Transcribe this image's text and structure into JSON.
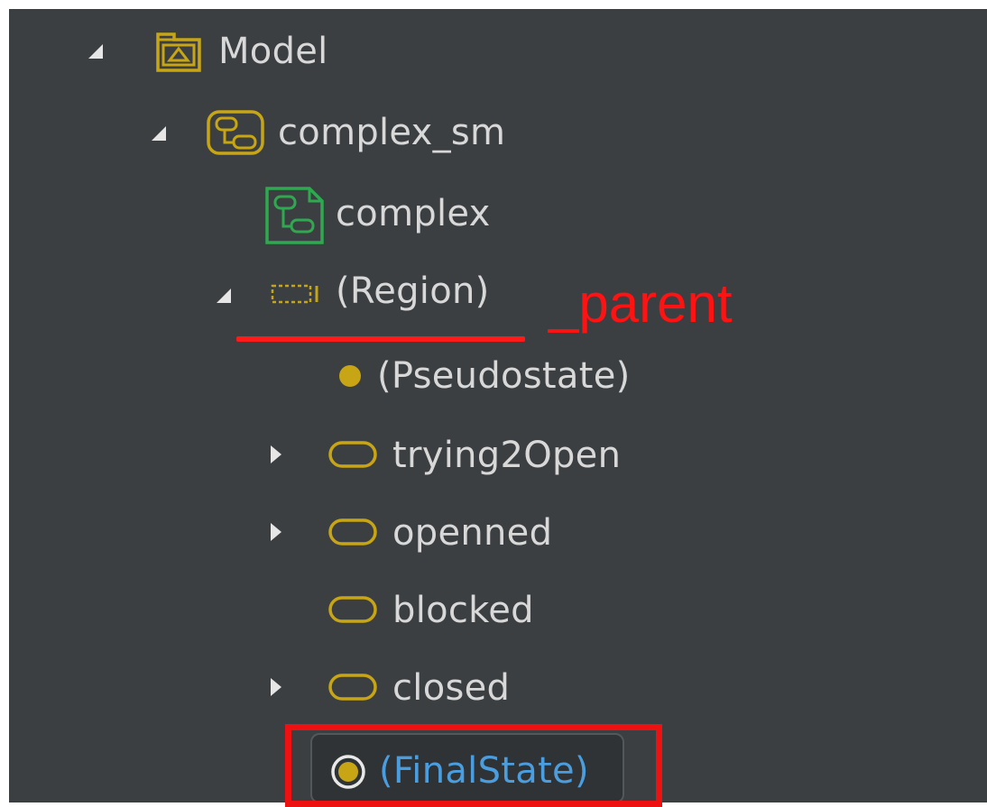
{
  "tree": {
    "model": {
      "label": "Model",
      "icon": "package-icon",
      "expanded": true
    },
    "state_machine": {
      "label": "complex_sm",
      "icon": "state-machine-icon",
      "expanded": true
    },
    "diagram": {
      "label": "complex",
      "icon": "state-machine-diagram-icon"
    },
    "region": {
      "label": "(Region)",
      "icon": "region-icon",
      "expanded": true
    },
    "pseudostate": {
      "label": "(Pseudostate)",
      "icon": "initial-pseudostate-icon"
    },
    "trying2open": {
      "label": "trying2Open",
      "icon": "state-icon",
      "expandable": true
    },
    "openned": {
      "label": "openned",
      "icon": "state-icon",
      "expandable": true
    },
    "blocked": {
      "label": "blocked",
      "icon": "state-icon",
      "expandable": false
    },
    "closed": {
      "label": "closed",
      "icon": "state-icon",
      "expandable": true
    },
    "final_state": {
      "label": "(FinalState)",
      "icon": "final-state-icon",
      "selected": true
    }
  },
  "annotation": {
    "text": "_parent",
    "color": "#ff1212"
  },
  "colors": {
    "background": "#3b3f42",
    "text": "#d8d8d8",
    "selected_text": "#4a9ee0",
    "icon_yellow": "#c7a514",
    "icon_green": "#2fa84f",
    "highlight_red": "#ee1111"
  }
}
